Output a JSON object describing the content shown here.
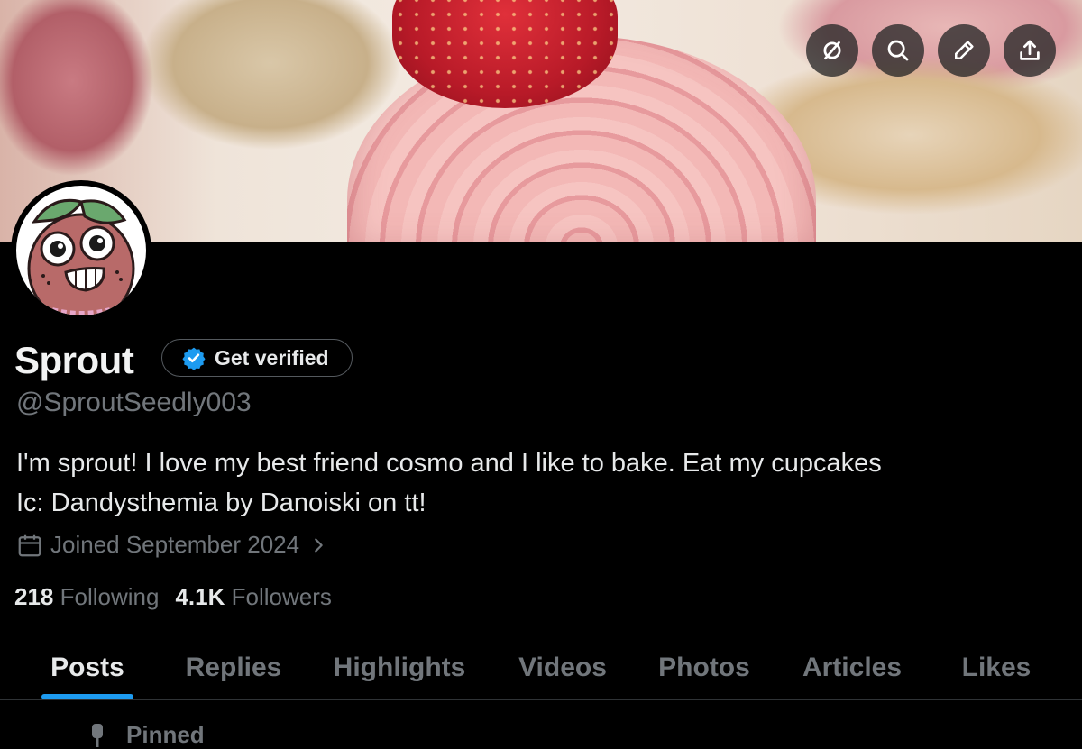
{
  "banner": {
    "buttons": [
      {
        "name": "hide-icon"
      },
      {
        "name": "search-icon"
      },
      {
        "name": "edit-icon"
      },
      {
        "name": "share-icon"
      }
    ]
  },
  "profile": {
    "name": "Sprout",
    "verify_label": "Get verified",
    "handle": "@SproutSeedly003",
    "bio_line1": "I'm sprout! I love my best friend cosmo and I like to bake. Eat my cupcakes",
    "bio_line2": "Ic: Dandysthemia by Danoiski on tt!",
    "joined": "Joined September 2024",
    "following_count": "218",
    "following_label": "Following",
    "followers_count": "4.1K",
    "followers_label": "Followers"
  },
  "tabs": [
    "Posts",
    "Replies",
    "Highlights",
    "Videos",
    "Photos",
    "Articles",
    "Likes"
  ],
  "active_tab": "Posts",
  "pinned_label": "Pinned",
  "colors": {
    "accent": "#1d9bf0",
    "verified": "#1d9bf0",
    "muted": "#71767b"
  }
}
